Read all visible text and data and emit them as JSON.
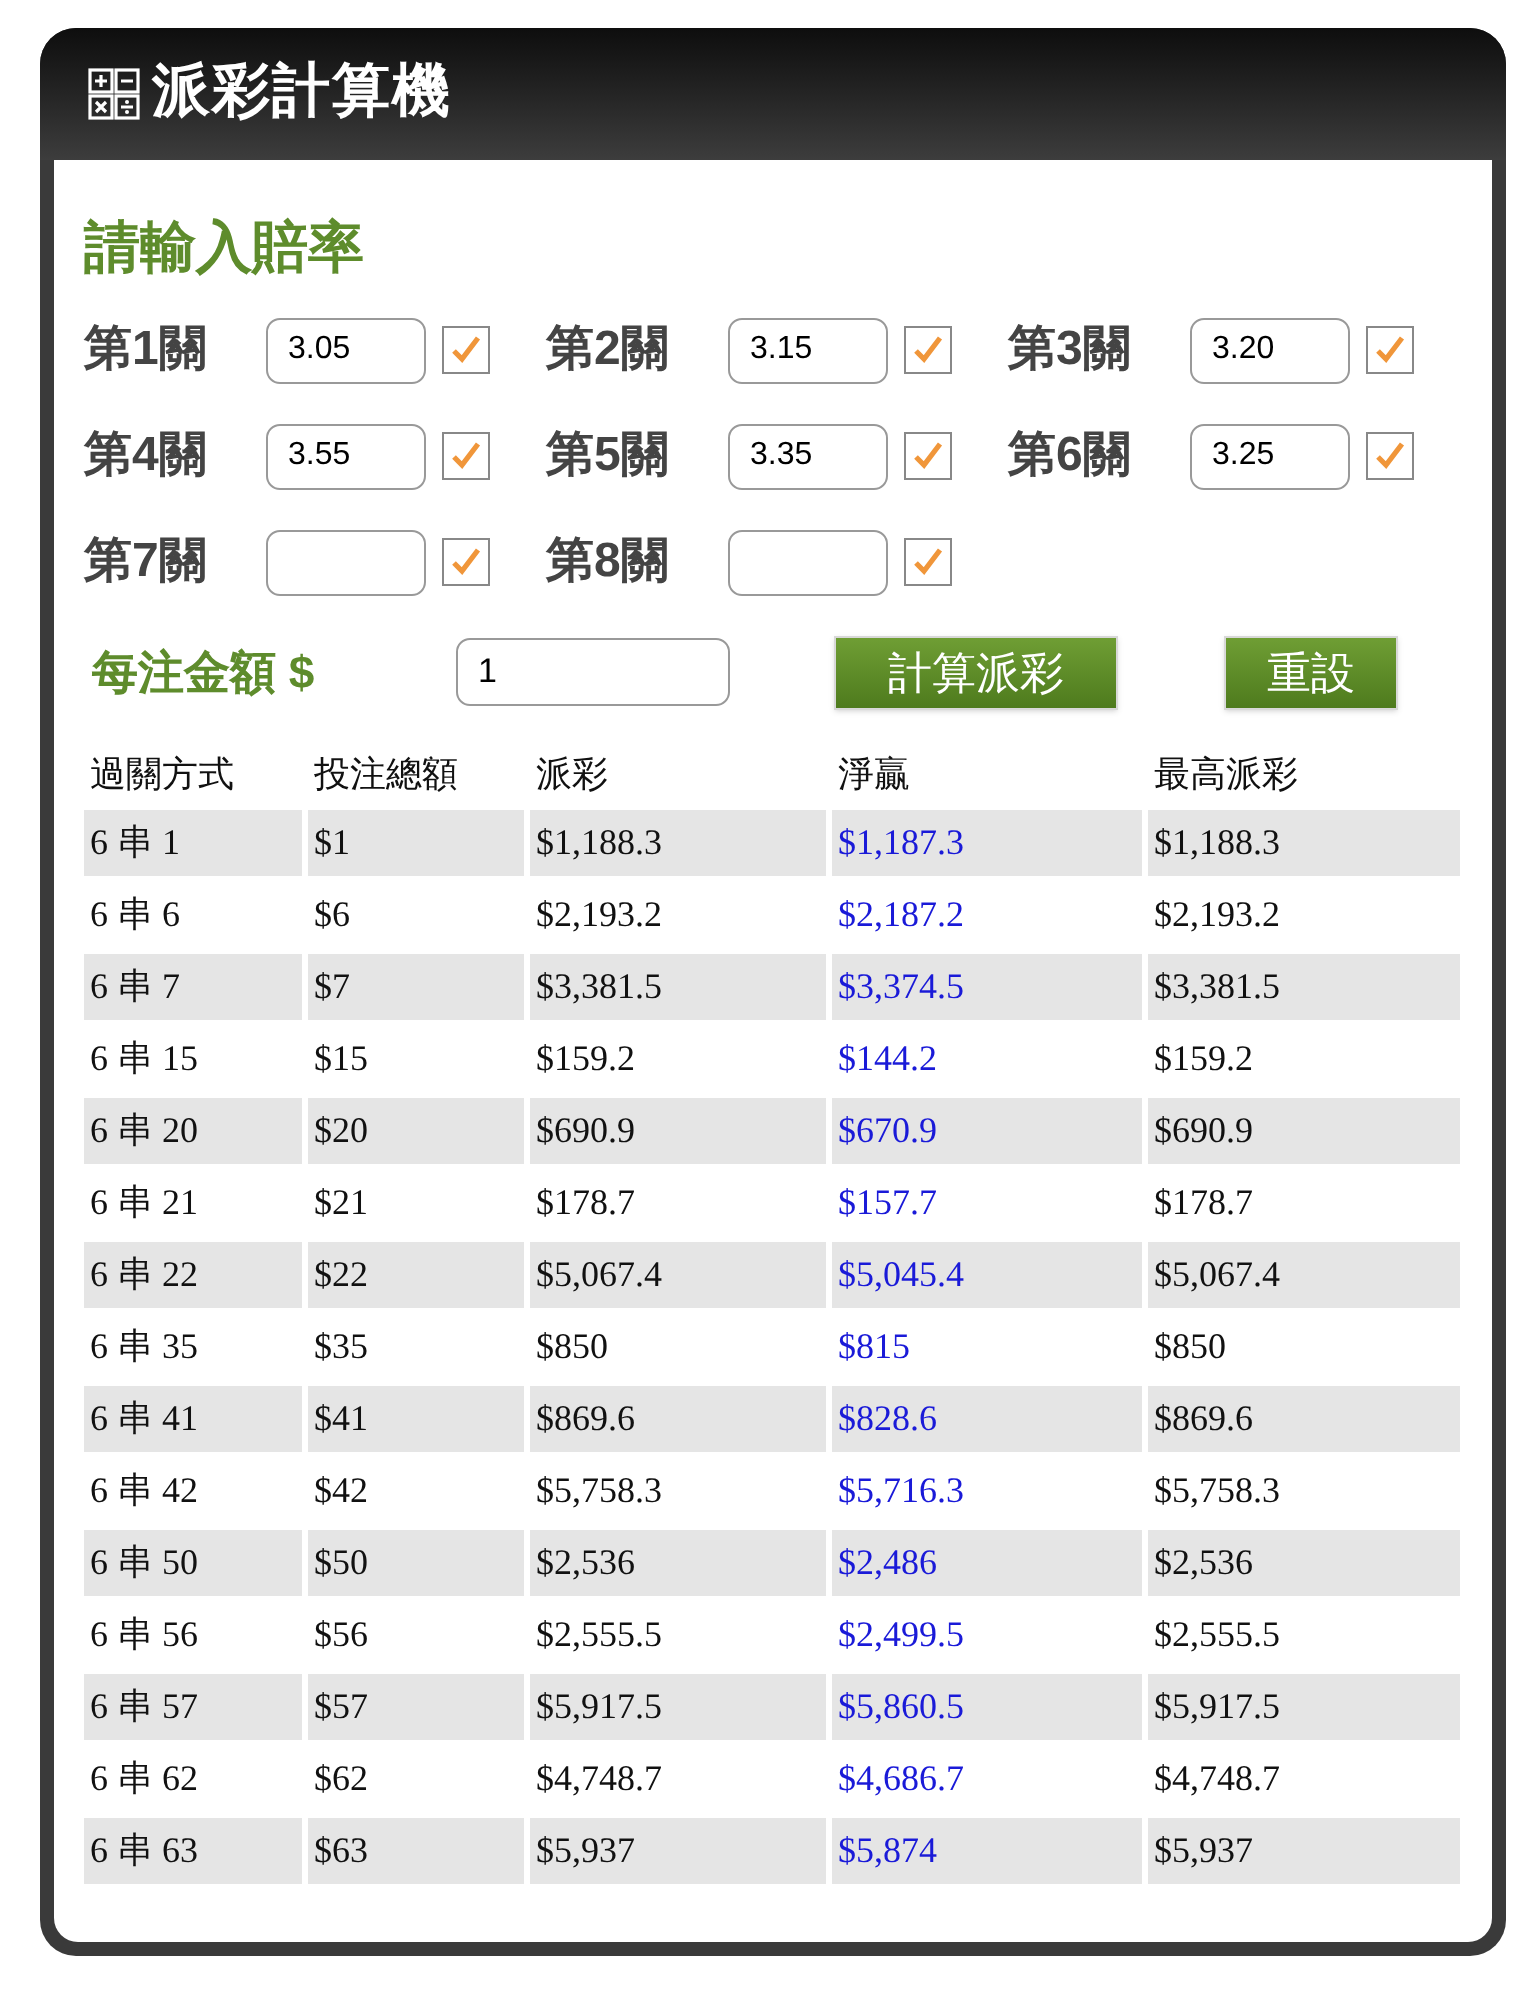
{
  "window": {
    "title": "派彩計算機"
  },
  "odds_section": {
    "title": "請輸入賠率"
  },
  "legs": [
    {
      "label": "第1關",
      "value": "3.05",
      "checked": true
    },
    {
      "label": "第2關",
      "value": "3.15",
      "checked": true
    },
    {
      "label": "第3關",
      "value": "3.20",
      "checked": true
    },
    {
      "label": "第4關",
      "value": "3.55",
      "checked": true
    },
    {
      "label": "第5關",
      "value": "3.35",
      "checked": true
    },
    {
      "label": "第6關",
      "value": "3.25",
      "checked": true
    },
    {
      "label": "第7關",
      "checked": true
    },
    {
      "label": "第8關",
      "checked": true
    }
  ],
  "stake": {
    "label": "每注金額 $",
    "value": "1"
  },
  "buttons": [
    "計算派彩",
    "重設"
  ],
  "table": {
    "columns": [
      "過關方式",
      "投注總額",
      "派彩",
      "淨贏",
      "最高派彩"
    ],
    "rows": [
      [
        "6 串 1",
        "$1",
        "$1,188.3",
        "$1,187.3",
        "$1,188.3"
      ],
      [
        "6 串 6",
        "$6",
        "$2,193.2",
        "$2,187.2",
        "$2,193.2"
      ],
      [
        "6 串 7",
        "$7",
        "$3,381.5",
        "$3,374.5",
        "$3,381.5"
      ],
      [
        "6 串 15",
        "$15",
        "$159.2",
        "$144.2",
        "$159.2"
      ],
      [
        "6 串 20",
        "$20",
        "$690.9",
        "$670.9",
        "$690.9"
      ],
      [
        "6 串 21",
        "$21",
        "$178.7",
        "$157.7",
        "$178.7"
      ],
      [
        "6 串 22",
        "$22",
        "$5,067.4",
        "$5,045.4",
        "$5,067.4"
      ],
      [
        "6 串 35",
        "$35",
        "$850",
        "$815",
        "$850"
      ],
      [
        "6 串 41",
        "$41",
        "$869.6",
        "$828.6",
        "$869.6"
      ],
      [
        "6 串 42",
        "$42",
        "$5,758.3",
        "$5,716.3",
        "$5,758.3"
      ],
      [
        "6 串 50",
        "$50",
        "$2,536",
        "$2,486",
        "$2,536"
      ],
      [
        "6 串 56",
        "$56",
        "$2,555.5",
        "$2,499.5",
        "$2,555.5"
      ],
      [
        "6 串 57",
        "$57",
        "$5,917.5",
        "$5,860.5",
        "$5,917.5"
      ],
      [
        "6 串 62",
        "$62",
        "$4,748.7",
        "$4,686.7",
        "$4,748.7"
      ],
      [
        "6 串 63",
        "$63",
        "$5,937",
        "$5,874",
        "$5,937"
      ]
    ]
  }
}
